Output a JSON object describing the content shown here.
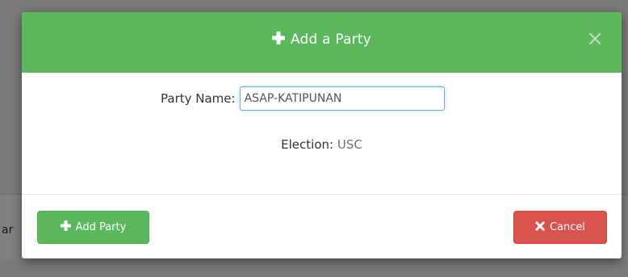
{
  "backdrop": {
    "partial_text": "ar"
  },
  "modal": {
    "title": "Add a Party",
    "title_icon": "plus-icon",
    "close_label": "×",
    "form": {
      "party_name_label": "Party Name:",
      "party_name_value": "ASAP-KATIPUNAN",
      "election_label": "Election:",
      "election_value": "USC"
    },
    "footer": {
      "add_label": "Add Party",
      "add_icon": "plus-icon",
      "cancel_label": "Cancel",
      "cancel_icon": "times-icon"
    }
  },
  "colors": {
    "success": "#5cb85c",
    "danger": "#d9534f",
    "focus_border": "#66afe9",
    "backdrop": "#7a7a7a"
  }
}
